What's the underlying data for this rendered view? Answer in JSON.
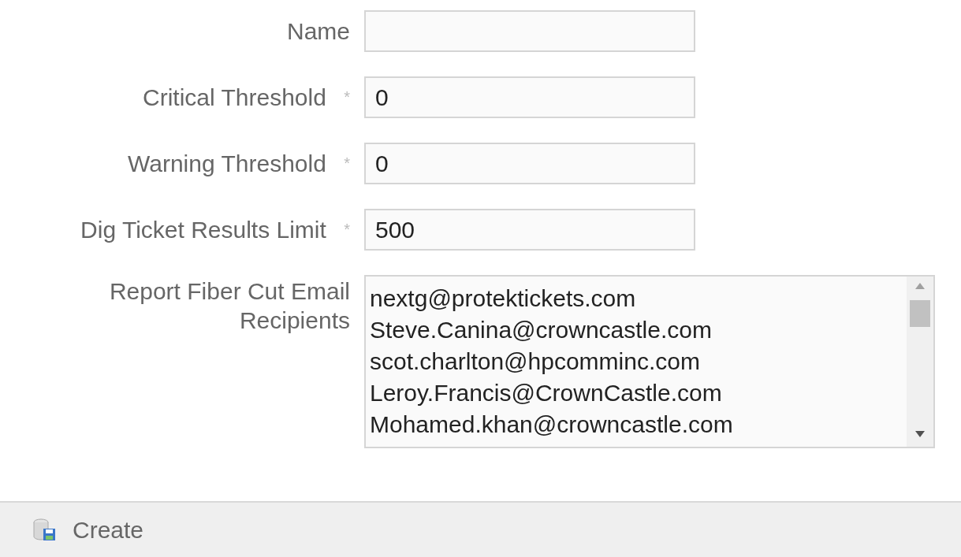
{
  "form": {
    "fields": [
      {
        "kind": "text",
        "label": "Name"
      },
      {
        "kind": "text",
        "label": "Critical Threshold",
        "required_mark": "*",
        "value": "0"
      },
      {
        "kind": "text",
        "label": "Warning Threshold",
        "required_mark": "*",
        "value": "0"
      },
      {
        "kind": "text",
        "label": "Dig Ticket Results Limit",
        "required_mark": "*",
        "value": "500"
      },
      {
        "kind": "textarea",
        "label": "Report Fiber Cut Email Recipients",
        "lines": [
          "nextg@protektickets.com",
          "Steve.Canina@crowncastle.com",
          "scot.charlton@hpcomminc.com",
          "Leroy.Francis@CrownCastle.com",
          "Mohamed.khan@crowncastle.com"
        ]
      }
    ]
  },
  "footer": {
    "create_button": "Create"
  }
}
